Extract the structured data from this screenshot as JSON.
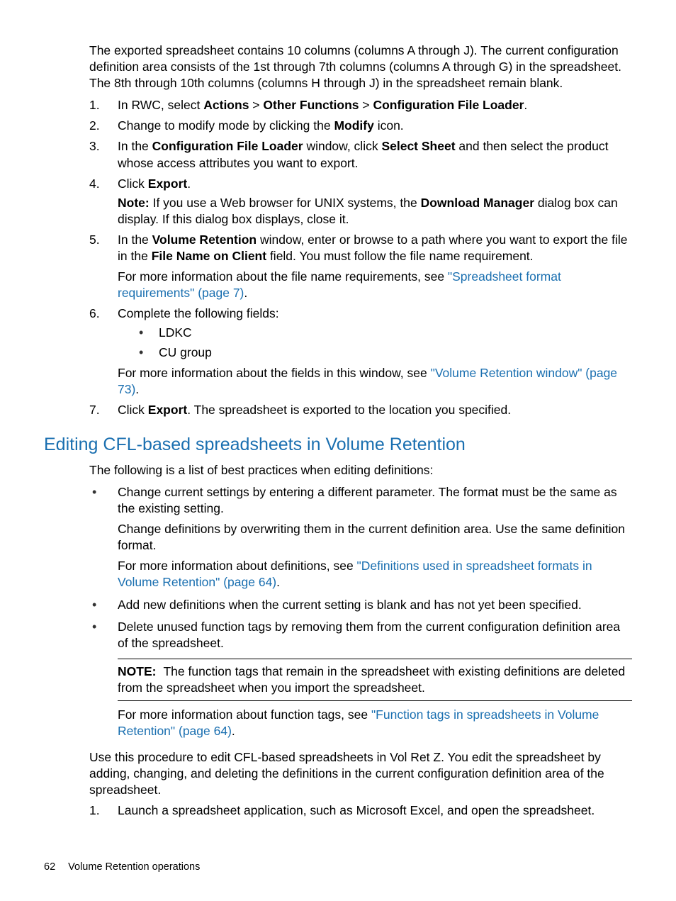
{
  "intro": "The exported spreadsheet contains 10 columns (columns A through J). The current configuration definition area consists of the 1st through 7th columns (columns A through G) in the spreadsheet. The 8th through 10th columns (columns H through J) in the spreadsheet remain blank.",
  "steps": {
    "s1": {
      "n": "1.",
      "pre": "In RWC, select ",
      "b1": "Actions",
      "sep1": " > ",
      "b2": "Other Functions",
      "sep2": " > ",
      "b3": "Configuration File Loader",
      "post": "."
    },
    "s2": {
      "n": "2.",
      "pre": "Change to modify mode by clicking the ",
      "b1": "Modify",
      "post": " icon."
    },
    "s3": {
      "n": "3.",
      "pre": "In the ",
      "b1": "Configuration File Loader",
      "mid": " window, click ",
      "b2": "Select Sheet",
      "post": " and then select the product whose access attributes you want to export."
    },
    "s4": {
      "n": "4.",
      "pre": "Click ",
      "b1": "Export",
      "post": ".",
      "note_label": "Note:",
      "note_pre": " If you use a Web browser for UNIX systems, the ",
      "note_b": "Download Manager",
      "note_post": " dialog box can display. If this dialog box displays, close it."
    },
    "s5": {
      "n": "5.",
      "pre": "In the ",
      "b1": "Volume Retention",
      "mid": " window, enter or browse to a path where you want to export the file in the ",
      "b2": "File Name on Client",
      "post": " field. You must follow the file name requirement.",
      "sub_pre": "For more information about the file name requirements, see ",
      "sub_link": "\"Spreadsheet format requirements\" (page 7)",
      "sub_post": "."
    },
    "s6": {
      "n": "6.",
      "text": "Complete the following fields:",
      "bul1": "LDKC",
      "bul2": "CU group",
      "sub_pre": "For more information about the fields in this window, see ",
      "sub_link": "\"Volume Retention window\" (page 73)",
      "sub_post": "."
    },
    "s7": {
      "n": "7.",
      "pre": "Click ",
      "b1": "Export",
      "post": ". The spreadsheet is exported to the location you specified."
    }
  },
  "heading": "Editing CFL-based spreadsheets in Volume Retention",
  "list_intro": "The following is a list of best practices when editing definitions:",
  "bullets": {
    "b1": {
      "p1": "Change current settings by entering a different parameter. The format must be the same as the existing setting.",
      "p2": "Change definitions by overwriting them in the current definition area. Use the same definition format.",
      "p3_pre": "For more information about definitions, see ",
      "p3_link": "\"Definitions used in spreadsheet formats in Volume Retention\" (page 64)",
      "p3_post": "."
    },
    "b2": {
      "text": "Add new definitions when the current setting is blank and has not yet been specified."
    },
    "b3": {
      "p1": "Delete unused function tags by removing them from the current configuration definition area of the spreadsheet.",
      "note_label": "NOTE:",
      "note_text": "The function tags that remain in the spreadsheet with existing definitions are deleted from the spreadsheet when you import the spreadsheet.",
      "p2_pre": "For more information about function tags, see ",
      "p2_link": "\"Function tags in spreadsheets in Volume Retention\" (page 64)",
      "p2_post": "."
    }
  },
  "outro": "Use this procedure to edit CFL-based spreadsheets in Vol Ret Z. You edit the spreadsheet by adding, changing, and deleting the definitions in the current configuration definition area of the spreadsheet.",
  "steps2": {
    "s1": {
      "n": "1.",
      "text": "Launch a spreadsheet application, such as Microsoft Excel, and open the spreadsheet."
    }
  },
  "footer": {
    "page": "62",
    "title": "Volume Retention operations"
  }
}
